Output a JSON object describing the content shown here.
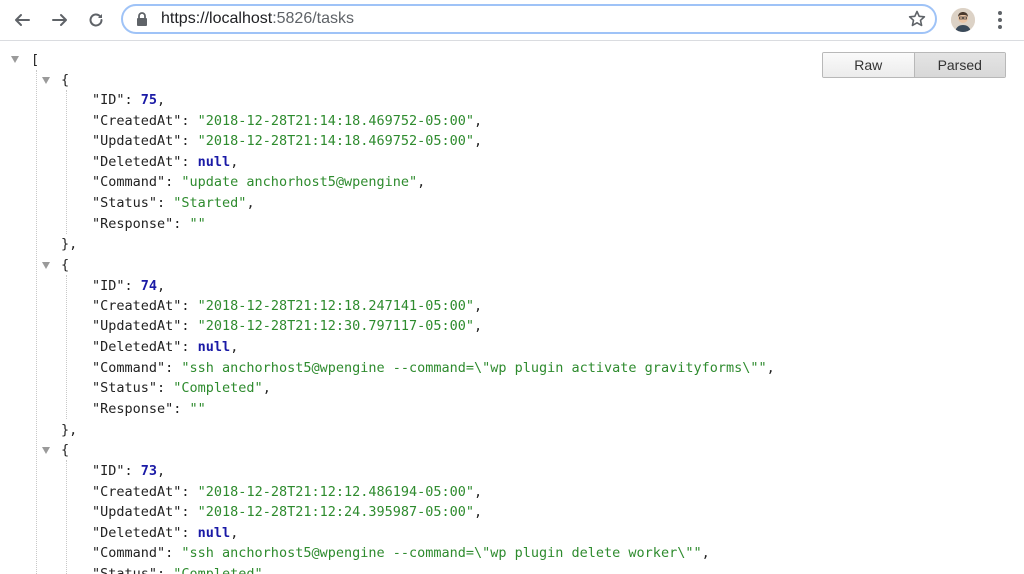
{
  "browser": {
    "url_scheme": "https://",
    "url_host": "localhost",
    "url_rest": ":5826/tasks"
  },
  "viewer": {
    "raw_label": "Raw",
    "parsed_label": "Parsed",
    "active": "Parsed"
  },
  "json": {
    "open_bracket": "[",
    "open_brace": "{",
    "close_brace_comma": "},",
    "tasks": [
      {
        "id": "75",
        "created_at": "\"2018-12-28T21:14:18.469752-05:00\"",
        "updated_at": "\"2018-12-28T21:14:18.469752-05:00\"",
        "deleted_at": "null",
        "command": "\"update anchorhost5@wpengine\"",
        "status": "\"Started\"",
        "response": "\"\""
      },
      {
        "id": "74",
        "created_at": "\"2018-12-28T21:12:18.247141-05:00\"",
        "updated_at": "\"2018-12-28T21:12:30.797117-05:00\"",
        "deleted_at": "null",
        "command": "\"ssh anchorhost5@wpengine --command=\\\"wp plugin activate gravityforms\\\"\"",
        "status": "\"Completed\"",
        "response": "\"\""
      },
      {
        "id": "73",
        "created_at": "\"2018-12-28T21:12:12.486194-05:00\"",
        "updated_at": "\"2018-12-28T21:12:24.395987-05:00\"",
        "deleted_at": "null",
        "command": "\"ssh anchorhost5@wpengine --command=\\\"wp plugin delete worker\\\"\"",
        "status": "\"Completed\""
      }
    ],
    "keys": {
      "id": "\"ID\": ",
      "created_at": "\"CreatedAt\": ",
      "updated_at": "\"UpdatedAt\": ",
      "deleted_at": "\"DeletedAt\": ",
      "command": "\"Command\": ",
      "status": "\"Status\": ",
      "response": "\"Response\": "
    }
  },
  "colors": {
    "string": "#2e8b2e",
    "number": "#1a1aa6",
    "omnibox_border": "#9fc3f7"
  },
  "icons": [
    "back-arrow-icon",
    "forward-arrow-icon",
    "reload-icon",
    "lock-icon",
    "star-icon",
    "avatar",
    "menu-dots-icon",
    "collapse-triangle-icon"
  ]
}
